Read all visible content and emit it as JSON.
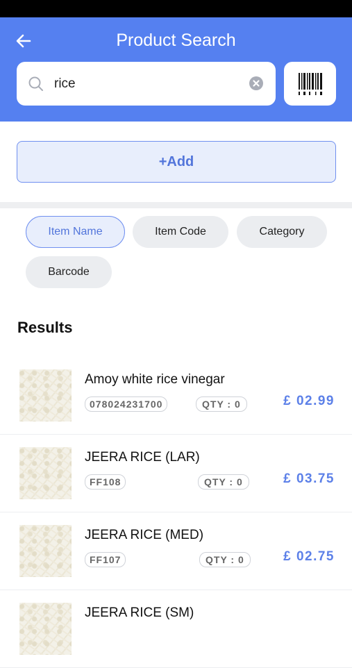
{
  "header": {
    "title": "Product Search"
  },
  "search": {
    "value": "rice",
    "placeholder": "Search"
  },
  "actions": {
    "add_label": "+Add"
  },
  "filters": [
    {
      "label": "Item Name",
      "active": true
    },
    {
      "label": "Item Code",
      "active": false
    },
    {
      "label": "Category",
      "active": false
    },
    {
      "label": "Barcode",
      "active": false
    }
  ],
  "results": {
    "title": "Results",
    "items": [
      {
        "name": "Amoy white rice vinegar",
        "code": "078024231700",
        "qty": "QTY : 0",
        "price": "£ 02.99"
      },
      {
        "name": "JEERA RICE (LAR)",
        "code": "FF108",
        "qty": "QTY : 0",
        "price": "£ 03.75"
      },
      {
        "name": "JEERA RICE (MED)",
        "code": "FF107",
        "qty": "QTY : 0",
        "price": "£ 02.75"
      },
      {
        "name": "JEERA RICE (SM)",
        "code": "",
        "qty": "",
        "price": ""
      }
    ]
  },
  "colors": {
    "brand": "#5580f0",
    "accent_text": "#5275db",
    "price": "#5c80e8"
  },
  "icons": [
    "back-arrow-icon",
    "search-icon",
    "clear-icon",
    "barcode-icon"
  ]
}
